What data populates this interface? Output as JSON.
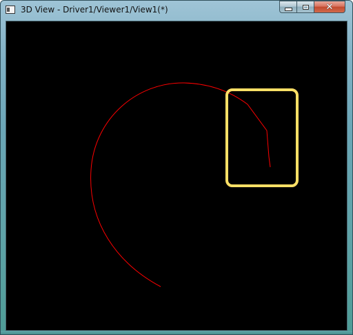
{
  "window": {
    "title": "3D View - Driver1/Viewer1/View1(*)",
    "icon": "app-window-icon",
    "caption_buttons": {
      "minimize_icon": "minimize-icon",
      "maximize_icon": "maximize-icon",
      "close_icon": "close-icon",
      "close_glyph": "✕"
    }
  },
  "viewport": {
    "background_color": "#000000",
    "curve_color": "#ff0000",
    "highlight_color": "#ffe066"
  }
}
